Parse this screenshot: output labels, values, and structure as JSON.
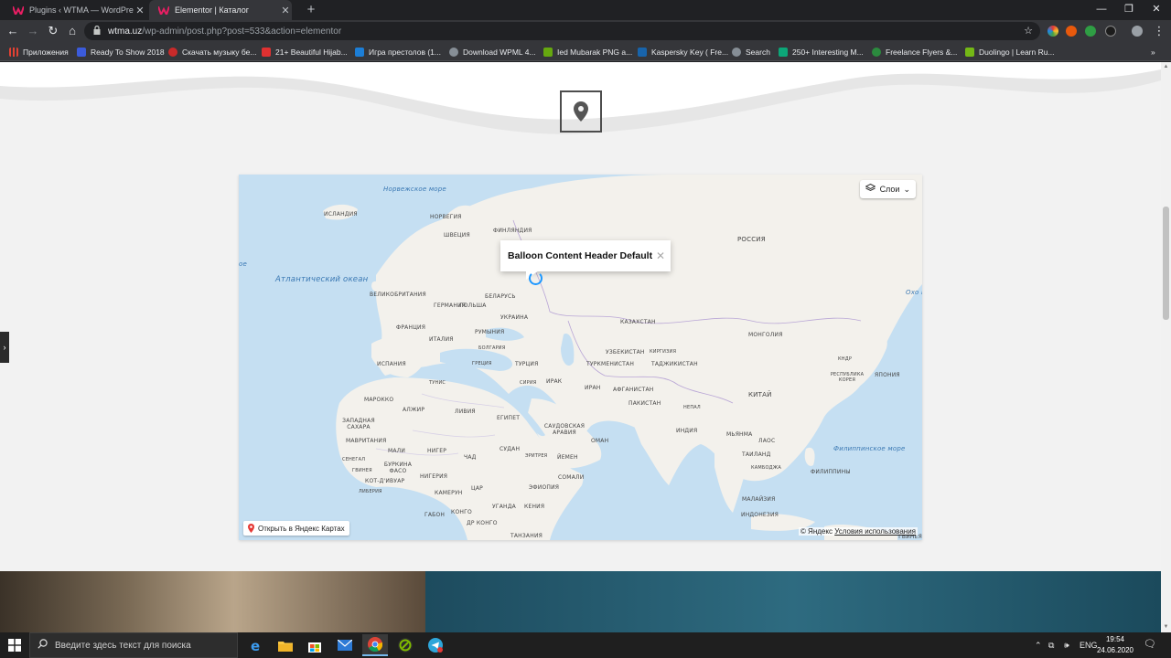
{
  "tabs": [
    {
      "title": "Plugins ‹ WTMA — WordPress",
      "active": false
    },
    {
      "title": "Elementor | Каталог",
      "active": true
    }
  ],
  "address": {
    "host": "wtma.uz",
    "path": "/wp-admin/post.php?post=533&action=elementor"
  },
  "bookmarks": [
    {
      "label": "Приложения",
      "color": "#e34133"
    },
    {
      "label": "Ready To Show 2018",
      "color": "#3b5bdb"
    },
    {
      "label": "Скачать музыку бе...",
      "color": "#c92a2a"
    },
    {
      "label": "21+ Beautiful Hijab...",
      "color": "#e03131"
    },
    {
      "label": "Игра престолов (1...",
      "color": "#1c7ed6"
    },
    {
      "label": "Download WPML 4...",
      "color": "#868e96"
    },
    {
      "label": "Ied Mubarak PNG a...",
      "color": "#66a80f"
    },
    {
      "label": "Kaspersky Key ( Fre...",
      "color": "#1864ab"
    },
    {
      "label": "Search",
      "color": "#868e96"
    },
    {
      "label": "250+ Interesting M...",
      "color": "#0ca678"
    },
    {
      "label": "Freelance Flyers &...",
      "color": "#2b8a3e"
    },
    {
      "label": "Duolingo | Learn Ru...",
      "color": "#74b816"
    }
  ],
  "map": {
    "layers_label": "Слои",
    "balloon_title": "Balloon Content Header Default",
    "open_link": "Открыть в Яндекс Картах",
    "copyright_brand": "© Яндекс",
    "copyright_terms": "Условия использования",
    "labels": {
      "norwegian_sea": "Норвежское море",
      "iceland": "ИСЛАНДИЯ",
      "norway": "НОРВЕГИЯ",
      "sweden": "ШВЕЦИЯ",
      "finland": "ФИНЛЯНДИЯ",
      "russia": "РОССИЯ",
      "atlantic": "Атлантический океан",
      "uk": "ВЕЛИКОБРИТАНИЯ",
      "germany": "ГЕРМАНИЯ",
      "poland": "ПОЛЬША",
      "belarus": "БЕЛАРУСЬ",
      "ukraine": "УКРАИНА",
      "france": "ФРАНЦИЯ",
      "romania": "РУМЫНИЯ",
      "italy": "ИТАЛИЯ",
      "bulgaria": "БОЛГАРИЯ",
      "kazakhstan": "КАЗАХСТАН",
      "mongolia": "МОНГОЛИЯ",
      "uzbekistan": "УЗБЕКИСТАН",
      "kyrgyzstan": "КИРГИЗИЯ",
      "turkmenistan": "ТУРКМЕНИСТАН",
      "tajikistan": "ТАДЖИКИСТАН",
      "spain": "ИСПАНИЯ",
      "greece": "ГРЕЦИЯ",
      "turkey": "ТУРЦИЯ",
      "tunisia": "ТУНИС",
      "syria": "СИРИЯ",
      "iraq": "ИРАК",
      "iran": "ИРАН",
      "afghanistan": "АФГАНИСТАН",
      "pakistan": "ПАКИСТАН",
      "nepal": "НЕПАЛ",
      "china": "КИТАЙ",
      "dprk": "КНДР",
      "korea": "РЕСПУБЛИКА КОРЕЯ",
      "japan": "ЯПОНИЯ",
      "morocco": "МАРОККО",
      "algeria": "АЛЖИР",
      "libya": "ЛИВИЯ",
      "egypt": "ЕГИПЕТ",
      "saudi": "САУДОВСКАЯ АРАВИЯ",
      "oman": "ОМАН",
      "india": "ИНДИЯ",
      "myanmar": "МЬЯНМА",
      "laos": "ЛАОС",
      "thailand": "ТАИЛАНД",
      "cambodia": "КАМБОДЖА",
      "philippine_sea": "Филиппинское море",
      "philippines": "ФИЛИППИНЫ",
      "west_sahara": "ЗАПАДНАЯ САХАРА",
      "mauritania": "МАВРИТАНИЯ",
      "mali": "МАЛИ",
      "niger": "НИГЕР",
      "chad": "ЧАД",
      "sudan": "СУДАН",
      "eritrea": "ЭРИТРЕЯ",
      "yemen": "ЙЕМЕН",
      "senegal": "СЕНЕГАЛ",
      "guinea": "ГВИНЕЯ",
      "burkina": "БУРКИНА ФАСО",
      "nigeria": "НИГЕРИЯ",
      "cote_divoire": "КОТ-Д'ИВУАР",
      "liberia": "ЛИБЕРИЯ",
      "ethiopia": "ЭФИОПИЯ",
      "somalia": "СОМАЛИ",
      "cameroon": "КАМЕРУН",
      "car": "ЦАР",
      "malaysia": "МАЛАЙЗИЯ",
      "uganda": "УГАНДА",
      "kenya": "КЕНИЯ",
      "gabon": "ГАБОН",
      "congo": "КОНГО",
      "drc": "ДР КОНГО",
      "indonesia": "ИНДОНЕЗИЯ",
      "tanzania": "ТАНЗАНИЯ",
      "okhotsk": "Охо м",
      "sea_fragment": "ое",
      "papua": "ГВИНЕЯ"
    }
  },
  "taskbar": {
    "search_placeholder": "Введите здесь текст для поиска",
    "lang": "ENG",
    "time": "19:54",
    "date": "24.06.2020"
  }
}
